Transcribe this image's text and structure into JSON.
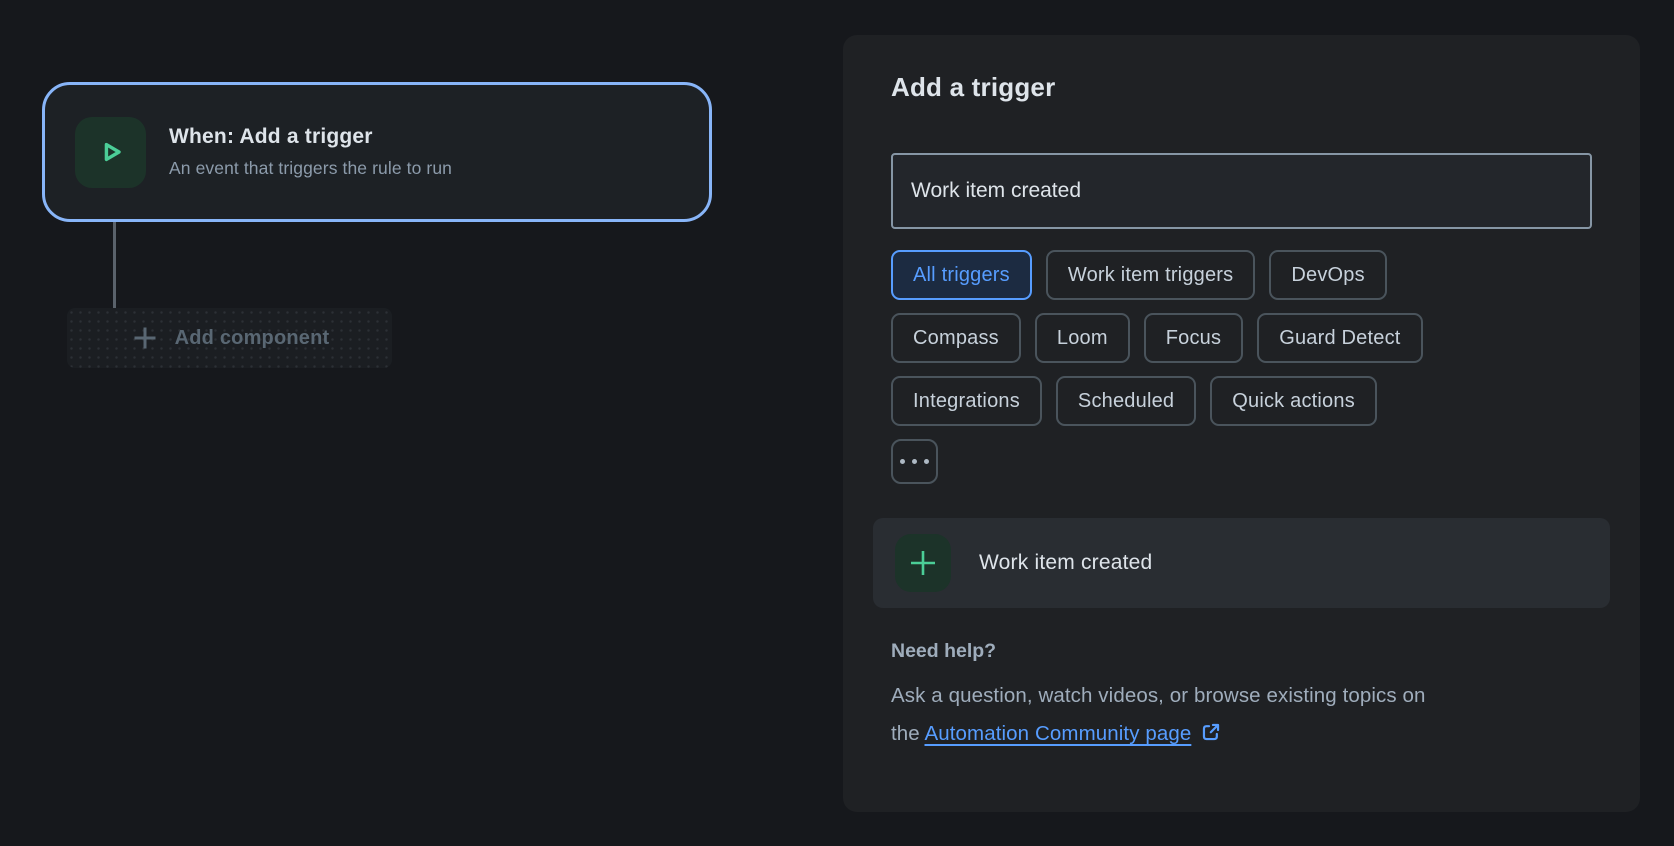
{
  "colors": {
    "canvas_bg": "#16181C",
    "panel_bg": "#1F2124",
    "node_bg": "#1D2125",
    "node_border": "#88B5F8",
    "accent_blue": "#579DFF",
    "selected_chip_bg": "#1C2B41",
    "green": "#4BCE97",
    "green_icon_bg": "#1C3329",
    "text_primary": "#DEE4EA",
    "text_muted": "#8C9BAB",
    "text_help": "#9FADBC"
  },
  "canvas": {
    "trigger_node": {
      "title": "When: Add a trigger",
      "subtitle": "An event that triggers the rule to run",
      "icon": "play-icon"
    },
    "add_component": {
      "label": "Add component",
      "icon": "plus-icon"
    }
  },
  "panel": {
    "title": "Add a trigger",
    "search": {
      "value": "Work item created"
    },
    "filters": [
      "All triggers",
      "Work item triggers",
      "DevOps",
      "Compass",
      "Loom",
      "Focus",
      "Guard Detect",
      "Integrations",
      "Scheduled",
      "Quick actions"
    ],
    "selected_filter": "All triggers",
    "more_filters_icon": "ellipsis-icon",
    "results": [
      {
        "label": "Work item created",
        "icon": "plus-icon"
      }
    ],
    "help": {
      "heading": "Need help?",
      "line1": "Ask a question, watch videos, or browse existing topics on",
      "line2_prefix": "the",
      "link_text": "Automation Community page",
      "link_icon": "external-link-icon"
    }
  }
}
